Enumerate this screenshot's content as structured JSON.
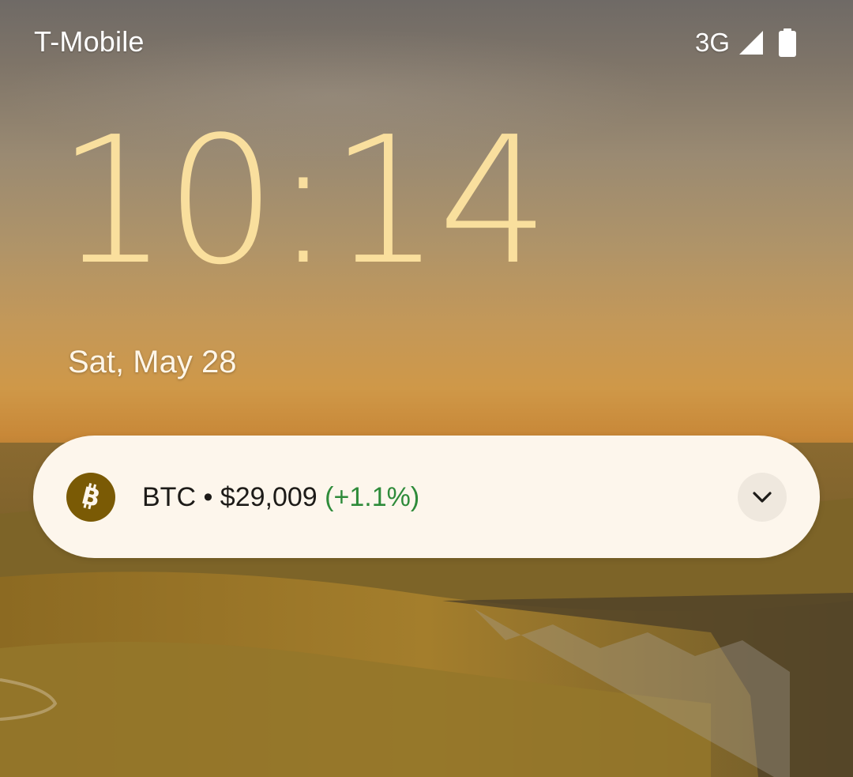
{
  "status_bar": {
    "carrier": "T-Mobile",
    "network_type": "3G",
    "icons": [
      "signal-icon",
      "battery-icon"
    ]
  },
  "lock_screen": {
    "time": "10:14",
    "date": "Sat, May 28"
  },
  "notification": {
    "icon": "bitcoin-icon",
    "ticker": "BTC",
    "separator": " • ",
    "price": "$29,009",
    "change": "(+1.1%)",
    "expand_icon": "chevron-down-icon"
  },
  "colors": {
    "clock": "#fde3a0",
    "notification_bg": "#fdf6ec",
    "positive_change": "#2e8b3a",
    "coin_icon_bg": "#7a5a05"
  }
}
